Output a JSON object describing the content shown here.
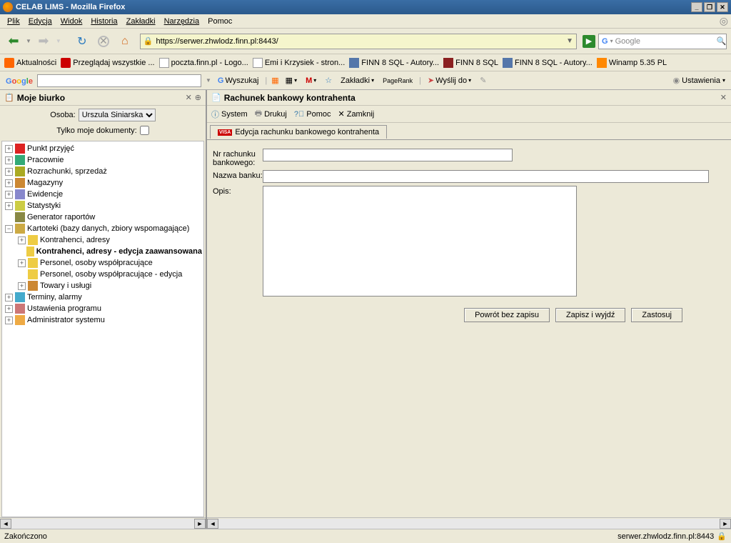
{
  "window": {
    "title": "CELAB LIMS - Mozilla Firefox"
  },
  "menu": {
    "plik": "Plik",
    "edycja": "Edycja",
    "widok": "Widok",
    "historia": "Historia",
    "zakladki": "Zakładki",
    "narzedzia": "Narzędzia",
    "pomoc": "Pomoc"
  },
  "url": "https://serwer.zhwlodz.finn.pl:8443/",
  "search": {
    "placeholder": "Google"
  },
  "bookmarks": {
    "b1": "Aktualności",
    "b2": "Przeglądaj wszystkie ...",
    "b3": "poczta.finn.pl - Logo...",
    "b4": "Emi i Krzysiek - stron...",
    "b5": "FINN 8 SQL - Autory...",
    "b6": "FINN 8 SQL",
    "b7": "FINN 8 SQL - Autory...",
    "b8": "Winamp 5.35 PL"
  },
  "googlebar": {
    "wyszukaj": "Wyszukaj",
    "zakladki": "Zakładki",
    "pagerank": "PageRank",
    "wyslij": "Wyślij do",
    "ustawienia": "Ustawienia"
  },
  "left_panel": {
    "title": "Moje biurko",
    "osoba_label": "Osoba:",
    "osoba_value": "Urszula Siniarska",
    "tylko_label": "Tylko moje dokumenty:"
  },
  "tree": {
    "i1": "Punkt przyjęć",
    "i2": "Pracownie",
    "i3": "Rozrachunki, sprzedaż",
    "i4": "Magazyny",
    "i5": "Ewidencje",
    "i6": "Statystyki",
    "i7": "Generator raportów",
    "i8": "Kartoteki (bazy danych, zbiory wspomagające)",
    "i8a": "Kontrahenci, adresy",
    "i8b": "Kontrahenci, adresy - edycja zaawansowana",
    "i8c": "Personel, osoby współpracujące",
    "i8d": "Personel, osoby współpracujące - edycja",
    "i8e": "Towary i usługi",
    "i9": "Terminy, alarmy",
    "i10": "Ustawienia programu",
    "i11": "Administrator systemu"
  },
  "right_panel": {
    "title": "Rachunek bankowy kontrahenta",
    "toolbar": {
      "system": "System",
      "drukuj": "Drukuj",
      "pomoc": "Pomoc",
      "zamknij": "Zamknij"
    },
    "tab": "Edycja rachunku bankowego kontrahenta",
    "form": {
      "nr_label": "Nr rachunku bankowego:",
      "nazwa_label": "Nazwa banku:",
      "opis_label": "Opis:"
    },
    "buttons": {
      "powrot": "Powrót bez zapisu",
      "zapisz": "Zapisz i wyjdź",
      "zastosuj": "Zastosuj"
    }
  },
  "statusbar": {
    "left": "Zakończono",
    "right": "serwer.zhwlodz.finn.pl:8443"
  }
}
